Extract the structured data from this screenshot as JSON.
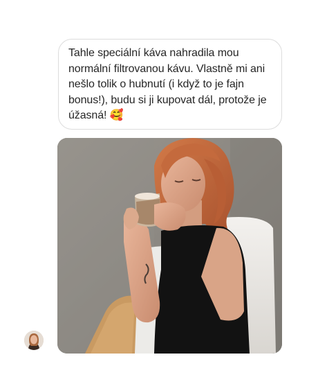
{
  "thread": {
    "message": {
      "text": "Tahle speciální káva nahradila mou normální filtrovanou kávu. Vlastně mi ani nešlo tolik o hubnutí (i když to je fajn bonus!), budu si ji kupovat dál, protože je úžasná! 🥰"
    },
    "photo": {
      "icon": "photo-woman-drinking-coffee"
    },
    "sender": {
      "avatar_icon": "user-avatar-icon"
    }
  },
  "colors": {
    "bubble_border": "#dcdcdc",
    "text": "#262626",
    "hair": "#c2683e",
    "wall": "#8e8b86"
  }
}
